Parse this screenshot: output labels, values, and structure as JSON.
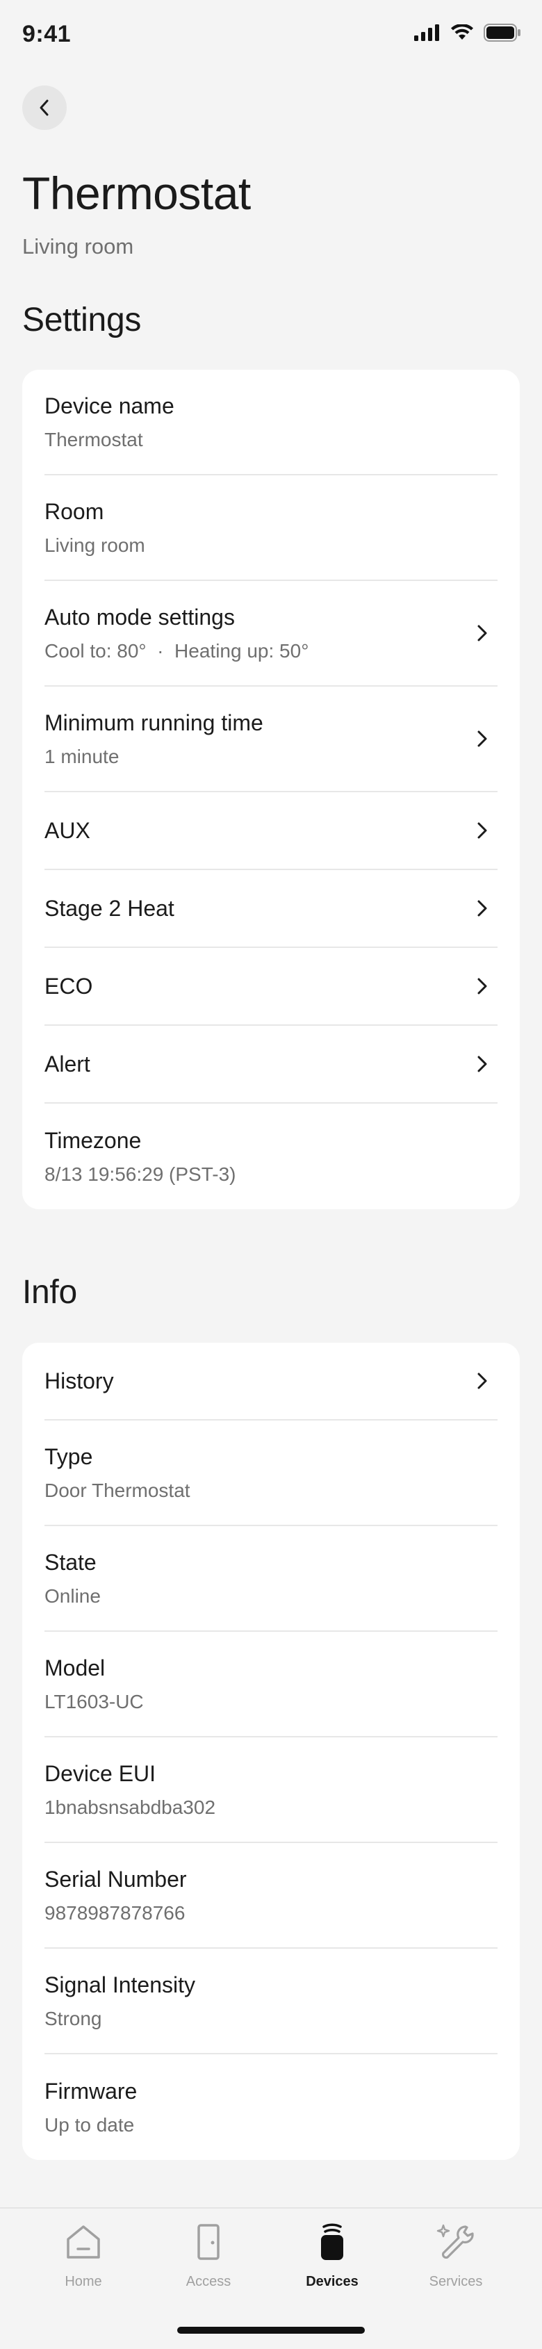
{
  "status_bar": {
    "time": "9:41"
  },
  "header": {
    "title": "Thermostat",
    "subtitle": "Living room"
  },
  "settings": {
    "heading": "Settings",
    "rows": [
      {
        "label": "Device name",
        "value": "Thermostat"
      },
      {
        "label": "Room",
        "value": "Living room"
      },
      {
        "label": "Auto mode settings",
        "value": "Cool to: 80°  ·  Heating up: 50°"
      },
      {
        "label": "Minimum running time",
        "value": "1 minute"
      },
      {
        "label": "AUX"
      },
      {
        "label": "Stage 2 Heat"
      },
      {
        "label": "ECO"
      },
      {
        "label": "Alert"
      },
      {
        "label": "Timezone",
        "value": "8/13 19:56:29 (PST-3)"
      }
    ]
  },
  "info": {
    "heading": "Info",
    "rows": [
      {
        "label": "History"
      },
      {
        "label": "Type",
        "value": "Door Thermostat"
      },
      {
        "label": "State",
        "value": "Online"
      },
      {
        "label": "Model",
        "value": "LT1603-UC"
      },
      {
        "label": "Device EUI",
        "value": "1bnabsnsabdba302"
      },
      {
        "label": "Serial Number",
        "value": "9878987878766"
      },
      {
        "label": "Signal Intensity",
        "value": "Strong"
      },
      {
        "label": "Firmware",
        "value": "Up to date"
      }
    ]
  },
  "bottom_nav": {
    "items": [
      {
        "label": "Home",
        "icon": "home-icon"
      },
      {
        "label": "Access",
        "icon": "door-icon"
      },
      {
        "label": "Devices",
        "icon": "device-icon",
        "active": true
      },
      {
        "label": "Services",
        "icon": "wrench-icon"
      }
    ]
  },
  "colors": {
    "background": "#f4f4f4",
    "card": "#ffffff",
    "text_primary": "#1b1b1b",
    "text_secondary": "#6f6f6f",
    "nav_inactive": "#a0a0a0"
  }
}
